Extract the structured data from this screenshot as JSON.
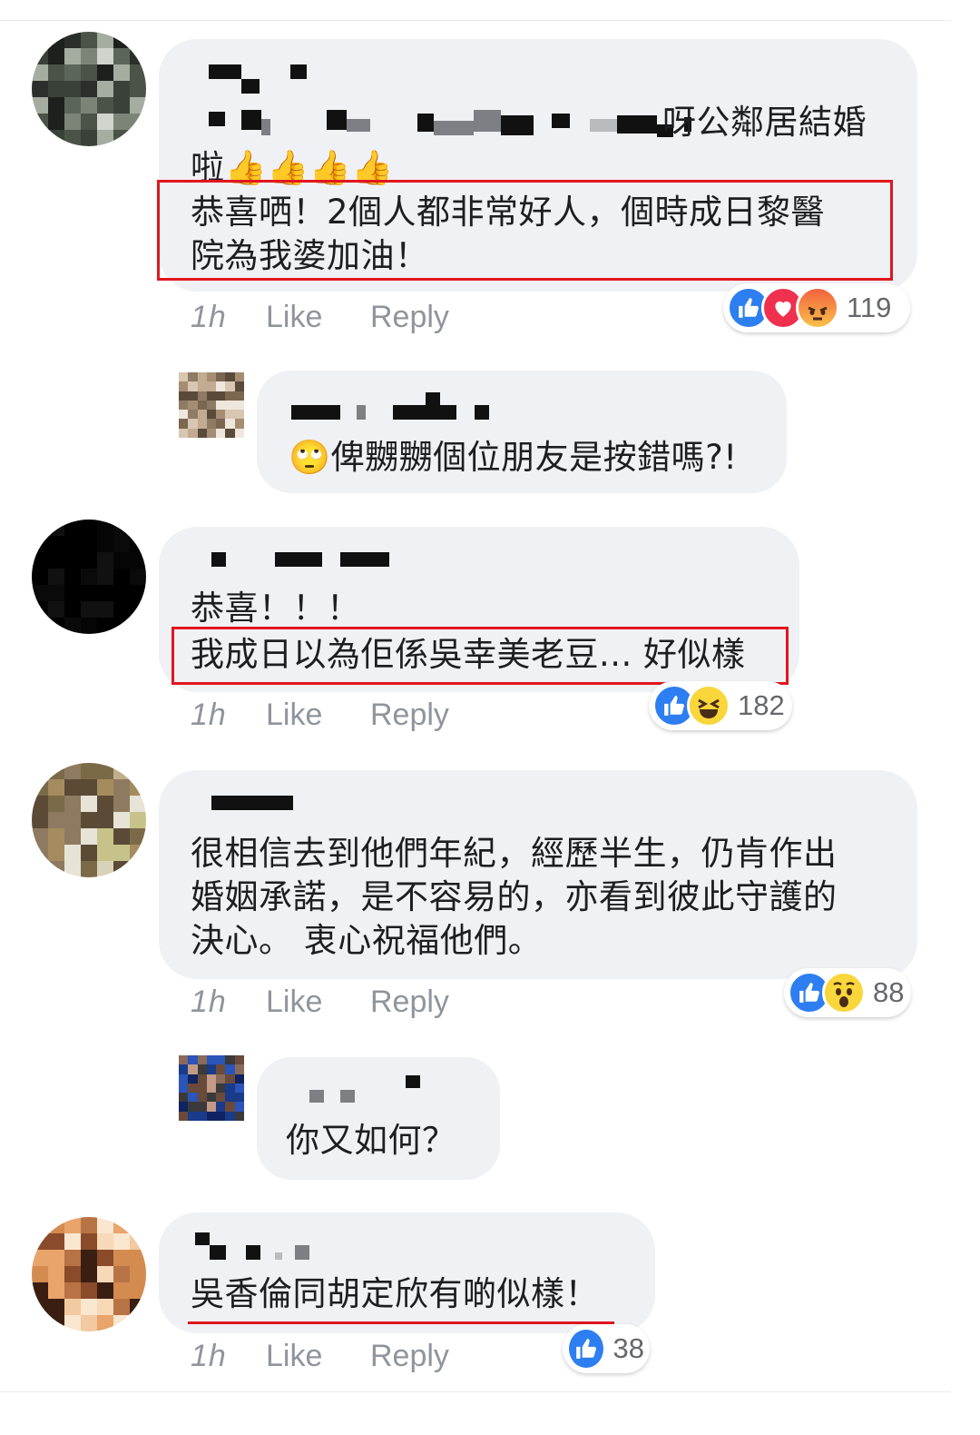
{
  "colors": {
    "bubble": "#f0f1f4",
    "highlight": "#e0161f",
    "meta_text": "#90949c",
    "like_blue": "#2d7ef0"
  },
  "comments": [
    {
      "lines": [
        "▪▪​▪ ▪▪ ▪ ▪▪ ▪ ▪▪▪▪呀公鄰居結婚",
        "啦👍👍👍👍"
      ],
      "highlight_lines": [
        "恭喜哂！2個人都非常好人，個時成日黎醫",
        "院為我婆加油！"
      ],
      "time": "1h",
      "like_label": "Like",
      "reply_label": "Reply",
      "reactions": [
        "like-icon",
        "love-icon",
        "angry-icon"
      ],
      "reaction_count": "119"
    },
    {
      "reply": true,
      "text": "🙄俾嬲嬲個位朋友是按錯嗎?!"
    },
    {
      "text": "恭喜！！！",
      "highlight": "我成日以為佢係吳幸美老豆... 好似樣",
      "time": "1h",
      "like_label": "Like",
      "reply_label": "Reply",
      "reactions": [
        "like-icon",
        "haha-icon"
      ],
      "reaction_count": "182"
    },
    {
      "lines": [
        "很相信去到他們年紀，經歷半生，仍肯作出",
        "婚姻承諾，是不容易的，亦看到彼此守護的",
        "決心。 衷心祝福他們。"
      ],
      "time": "1h",
      "like_label": "Like",
      "reply_label": "Reply",
      "reactions": [
        "like-icon",
        "wow-icon"
      ],
      "reaction_count": "88"
    },
    {
      "reply": true,
      "text": "你又如何？"
    },
    {
      "underlined": "吳香倫同胡定欣有啲似樣！",
      "time": "1h",
      "like_label": "Like",
      "reply_label": "Reply",
      "reactions": [
        "like-icon"
      ],
      "reaction_count": "38"
    }
  ]
}
